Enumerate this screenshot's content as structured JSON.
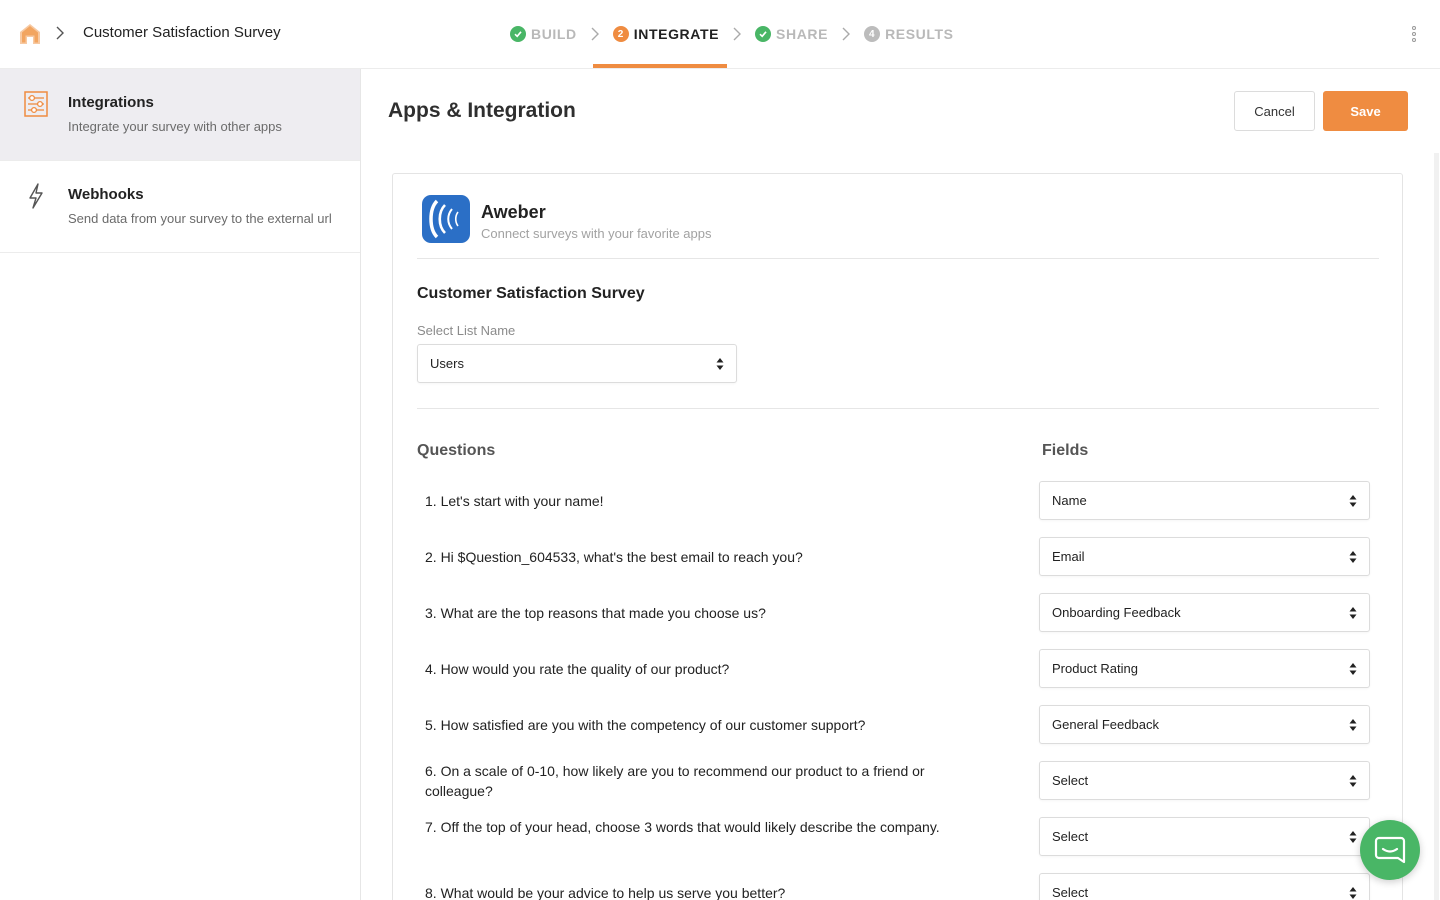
{
  "header": {
    "survey_title": "Customer Satisfaction Survey",
    "steps": [
      {
        "number": "1",
        "label": "BUILD",
        "state": "done"
      },
      {
        "number": "2",
        "label": "INTEGRATE",
        "state": "active"
      },
      {
        "number": "3",
        "label": "SHARE",
        "state": "done"
      },
      {
        "number": "4",
        "label": "RESULTS",
        "state": "todo"
      }
    ]
  },
  "sidebar": {
    "items": [
      {
        "title": "Integrations",
        "desc": "Integrate your survey with other apps",
        "icon": "sliders-icon",
        "active": true
      },
      {
        "title": "Webhooks",
        "desc": "Send data from your survey to the external url",
        "icon": "lightning-icon",
        "active": false
      }
    ]
  },
  "main": {
    "title": "Apps & Integration",
    "cancel_label": "Cancel",
    "save_label": "Save",
    "app": {
      "name": "Aweber",
      "desc": "Connect surveys with your favorite apps"
    },
    "form_title": "Customer Satisfaction Survey",
    "list_label": "Select List Name",
    "list_value": "Users",
    "questions_header": "Questions",
    "fields_header": "Fields",
    "questions": [
      {
        "text": "1. Let's start with your name!",
        "field": "Name"
      },
      {
        "text": "2. Hi $Question_604533, what's the best email to reach you?",
        "field": "Email"
      },
      {
        "text": "3. What are the top reasons that made you choose us?",
        "field": "Onboarding Feedback"
      },
      {
        "text": "4. How would you rate the quality of our product?",
        "field": "Product Rating"
      },
      {
        "text": "5. How satisfied are you with the competency of our customer support?",
        "field": "General Feedback"
      },
      {
        "text": "6. On a scale of 0-10, how likely are you to recommend our product to a friend or colleague?",
        "field": "Select"
      },
      {
        "text": "7. Off the top of your head, choose 3 words that would likely describe the company.",
        "field": "Select"
      },
      {
        "text": "8. What would be your advice to help us serve you better?",
        "field": "Select"
      }
    ]
  },
  "colors": {
    "accent": "#ef8c41",
    "success": "#49b666",
    "aweber_blue": "#2b6fc6"
  }
}
